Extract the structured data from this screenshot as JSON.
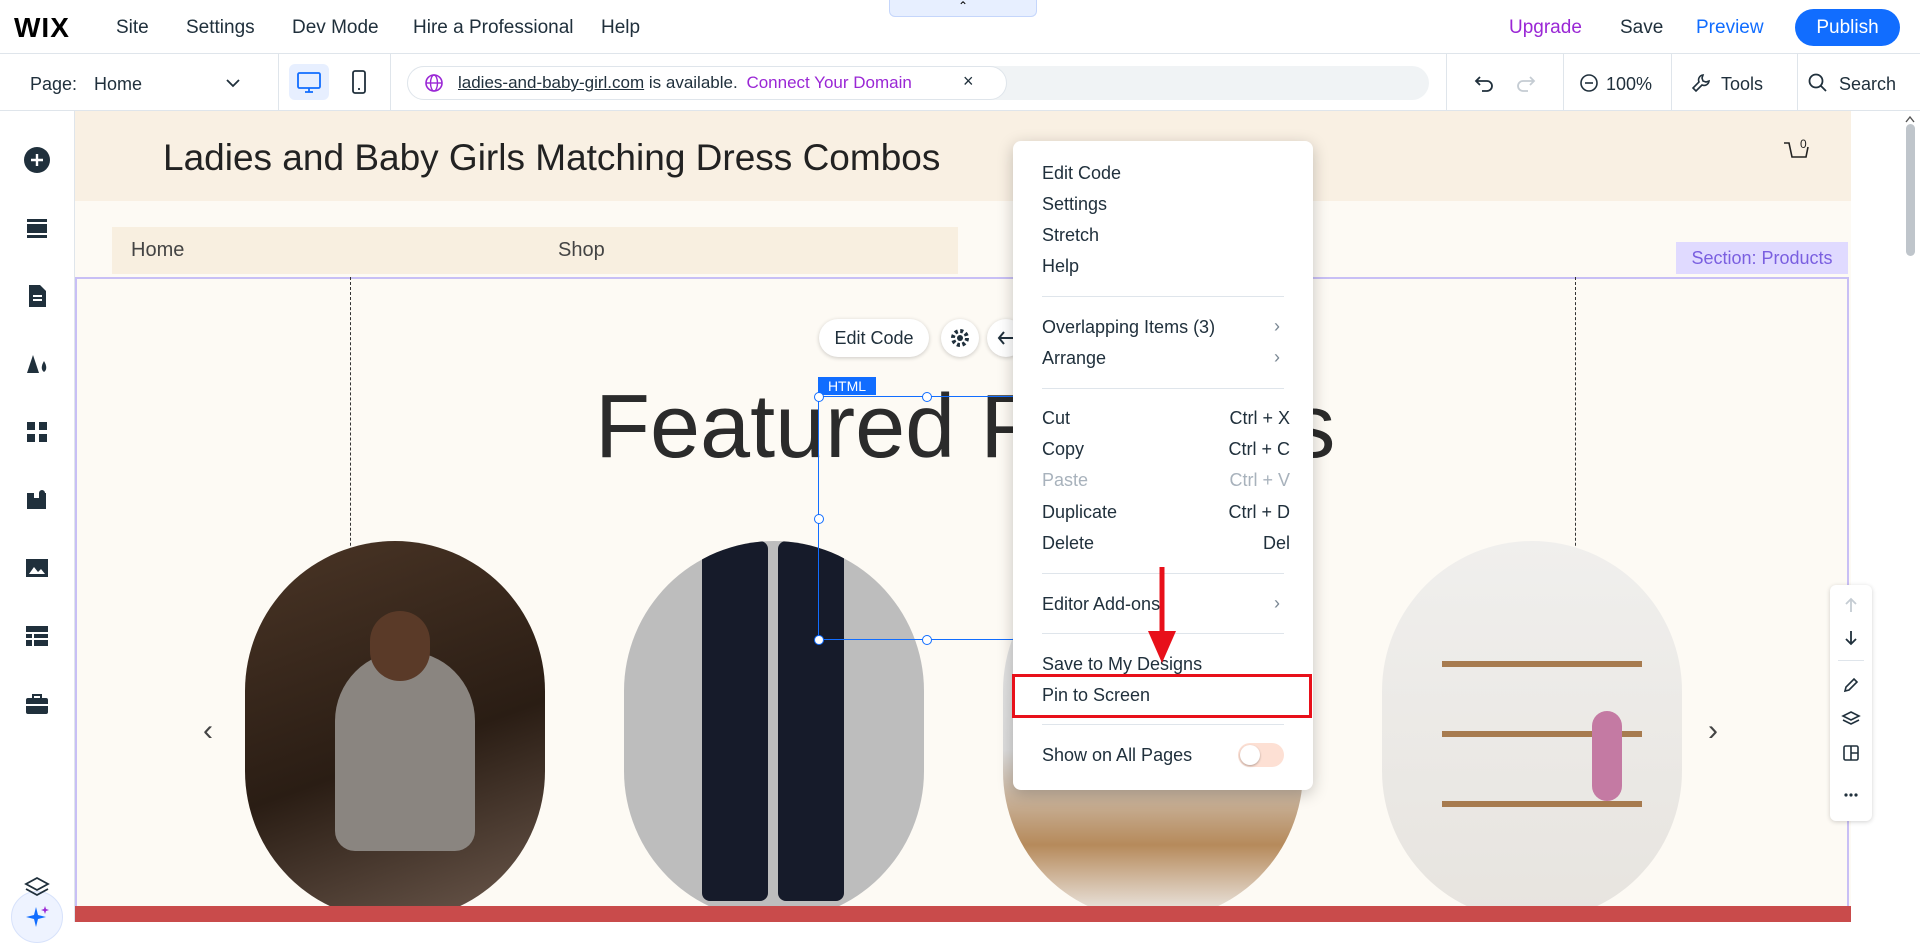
{
  "topbar": {
    "logo": "WIX",
    "menu": [
      "Site",
      "Settings",
      "Dev Mode",
      "Hire a Professional",
      "Help"
    ],
    "upgrade_label": "Upgrade",
    "save_label": "Save",
    "preview_label": "Preview",
    "publish_label": "Publish"
  },
  "subbar": {
    "page_label": "Page:",
    "page_value": "Home",
    "domain_name": "ladies-and-baby-girl.com",
    "domain_status": "is available.",
    "connect_label": "Connect Your Domain",
    "close_symbol": "×",
    "zoom": "100%",
    "tools_label": "Tools",
    "search_label": "Search"
  },
  "site": {
    "title": "Ladies and Baby Girls Matching Dress Combos",
    "cart_count": "0",
    "nav": [
      "Home",
      "Shop"
    ],
    "section_label": "Section: Products",
    "featured_title": "Featured Products",
    "edit_code_label": "Edit Code",
    "html_tag": "HTML",
    "prev_arrow": "‹",
    "next_arrow": "›"
  },
  "context_menu": {
    "group1": [
      "Edit Code",
      "Settings",
      "Stretch",
      "Help"
    ],
    "group2": [
      {
        "label": "Overlapping Items (3)",
        "submenu": true
      },
      {
        "label": "Arrange",
        "submenu": true
      }
    ],
    "group3": [
      {
        "label": "Cut",
        "shortcut": "Ctrl + X",
        "disabled": false
      },
      {
        "label": "Copy",
        "shortcut": "Ctrl + C",
        "disabled": false
      },
      {
        "label": "Paste",
        "shortcut": "Ctrl + V",
        "disabled": true
      },
      {
        "label": "Duplicate",
        "shortcut": "Ctrl + D",
        "disabled": false
      },
      {
        "label": "Delete",
        "shortcut": "Del",
        "disabled": false
      }
    ],
    "editor_addons": "Editor Add-ons",
    "save_designs": "Save to My Designs",
    "pin_to_screen": "Pin to Screen",
    "show_all_pages": "Show on All Pages",
    "show_all_pages_on": false,
    "submenu_symbol": "›"
  },
  "colors": {
    "accent": "#116dff",
    "upgrade": "#9a27d5",
    "highlight": "#e8101a",
    "section": "#c8bff5"
  }
}
